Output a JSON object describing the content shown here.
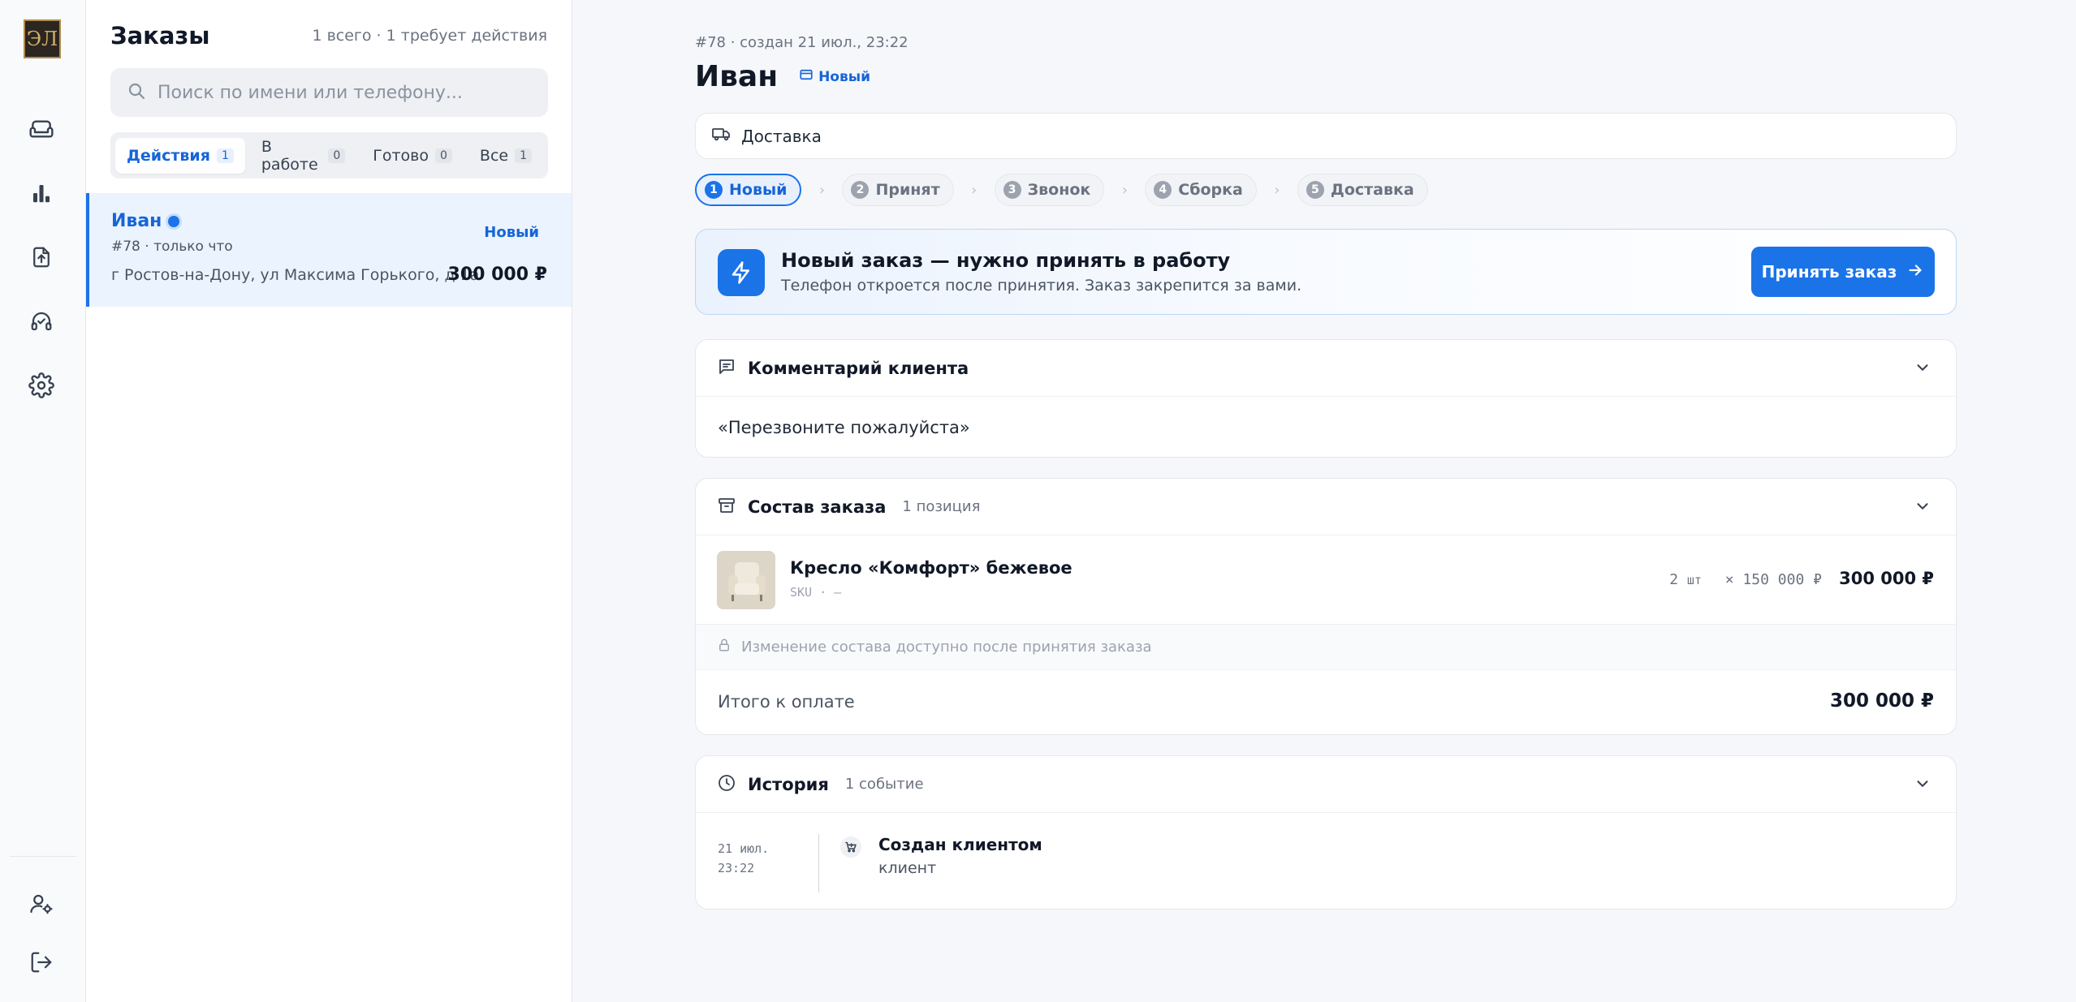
{
  "rail": {
    "logo_text": "ЭЛ",
    "items": [
      {
        "icon": "sofa-icon"
      },
      {
        "icon": "bar-chart-icon"
      },
      {
        "icon": "upload-file-icon"
      },
      {
        "icon": "headset-icon"
      },
      {
        "icon": "gear-icon"
      }
    ],
    "bottom": [
      {
        "icon": "user-settings-icon"
      },
      {
        "icon": "logout-icon"
      }
    ]
  },
  "list": {
    "title": "Заказы",
    "summary": "1 всего · 1 требует действия",
    "search_placeholder": "Поиск по имени или телефону...",
    "tabs": [
      {
        "label": "Действия",
        "count": "1",
        "active": true
      },
      {
        "label": "В работе",
        "count": "0",
        "active": false
      },
      {
        "label": "Готово",
        "count": "0",
        "active": false
      },
      {
        "label": "Все",
        "count": "1",
        "active": false
      }
    ],
    "orders": [
      {
        "name": "Иван",
        "meta": "#78 · только что",
        "status": "Новый",
        "address": "г Ростов-на-Дону, ул Максима Горького, д 1а",
        "price": "300 000 ₽"
      }
    ]
  },
  "order": {
    "crumb": "#78 · создан 21 июл., 23:22",
    "name": "Иван",
    "status_badge": "Новый",
    "delivery_label": "Доставка",
    "steps": [
      {
        "num": "1",
        "label": "Новый",
        "active": true
      },
      {
        "num": "2",
        "label": "Принят",
        "active": false
      },
      {
        "num": "3",
        "label": "Звонок",
        "active": false
      },
      {
        "num": "4",
        "label": "Сборка",
        "active": false
      },
      {
        "num": "5",
        "label": "Доставка",
        "active": false
      }
    ],
    "alert": {
      "title": "Новый заказ — нужно принять в работу",
      "subtitle": "Телефон откроется после принятия. Заказ закрепится за вами.",
      "button": "Принять заказ"
    },
    "comment": {
      "title": "Комментарий клиента",
      "text": "«Перезвоните пожалуйста»"
    },
    "composition": {
      "title": "Состав заказа",
      "count": "1 позиция",
      "items": [
        {
          "name": "Кресло «Комфорт» бежевое",
          "sku": "SKU · —",
          "qty": "2",
          "qty_unit": "шт",
          "unit_price": "× 150 000 ₽",
          "total": "300 000 ₽"
        }
      ],
      "lock_note": "Изменение состава доступно после принятия заказа",
      "total_label": "Итого к оплате",
      "total_value": "300 000 ₽"
    },
    "history": {
      "title": "История",
      "count": "1 событие",
      "events": [
        {
          "date": "21 июл.",
          "time": "23:22",
          "title": "Создан клиентом",
          "actor": "клиент"
        }
      ]
    }
  },
  "colors": {
    "accent": "#1b73e8",
    "accent_text": "#1565d8",
    "selected_bg": "#ebf3fe"
  }
}
